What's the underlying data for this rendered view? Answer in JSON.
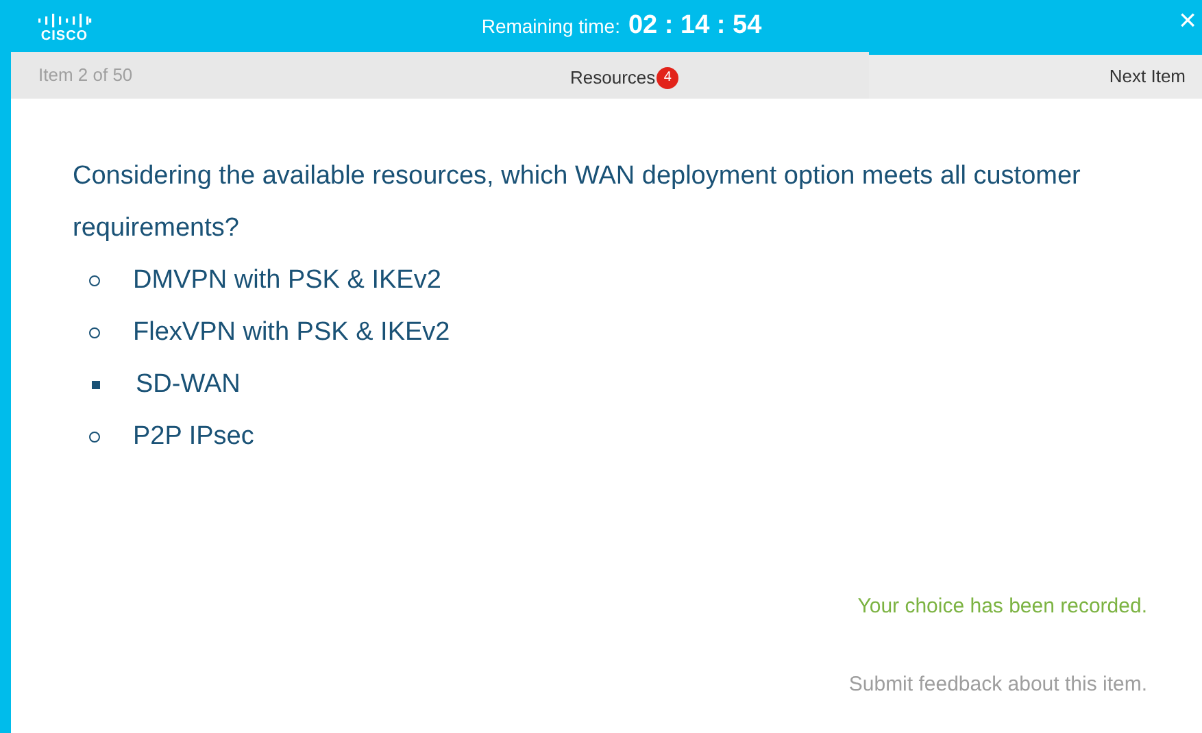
{
  "header": {
    "logo_text": "CISCO",
    "timer_label": "Remaining time:",
    "timer": "02 : 14 : 54",
    "close": "×"
  },
  "nav": {
    "item_counter": "Item 2 of 50",
    "resources": "Resources",
    "resources_count": "4",
    "next": "Next Item"
  },
  "question": "Considering the available resources, which WAN deployment option meets all customer requirements?",
  "options": [
    {
      "label": "DMVPN with PSK & IKEv2",
      "selected": false
    },
    {
      "label": "FlexVPN with PSK & IKEv2",
      "selected": false
    },
    {
      "label": "SD-WAN",
      "selected": true
    },
    {
      "label": "P2P IPsec",
      "selected": false
    }
  ],
  "status": "Your choice has been recorded.",
  "feedback_link": "Submit feedback about this item."
}
